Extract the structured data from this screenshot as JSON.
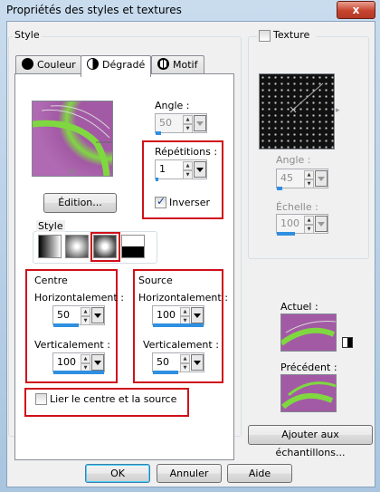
{
  "window": {
    "title": "Propriétés des styles et textures",
    "close_glyph": "x"
  },
  "style_group": {
    "label": "Style",
    "tabs": [
      {
        "label": "Couleur",
        "icon": "color-circle-icon",
        "active": false
      },
      {
        "label": "Dégradé",
        "icon": "gradient-circle-icon",
        "active": true
      },
      {
        "label": "Motif",
        "icon": "pattern-globe-icon",
        "active": false
      }
    ]
  },
  "gradient": {
    "edit_button": "Édition...",
    "angle_label": "Angle :",
    "angle_value": "50",
    "repetitions_label": "Répétitions :",
    "repetitions_value": "1",
    "invert_label": "Inverser",
    "invert_checked": true,
    "style_label": "Style",
    "style_buttons": [
      "linear-style-icon",
      "rectangular-style-icon",
      "sunburst-style-icon",
      "radial-style-icon"
    ],
    "selected_style": "sunburst-style-icon",
    "center": {
      "label": "Centre",
      "h_label": "Horizontalement :",
      "h_value": "50",
      "v_label": "Verticalement :",
      "v_value": "100"
    },
    "source": {
      "label": "Source",
      "h_label": "Horizontalement :",
      "h_value": "100",
      "v_label": "Verticalement :",
      "v_value": "50"
    },
    "link_label": "Lier le centre et la source",
    "link_checked": false
  },
  "texture": {
    "label": "Texture",
    "checked": false,
    "angle_label": "Angle :",
    "angle_value": "45",
    "scale_label": "Échelle :",
    "scale_value": "100"
  },
  "current": {
    "label": "Actuel :"
  },
  "previous": {
    "label": "Précédent :"
  },
  "add_samples_button": "Ajouter aux échantillons...",
  "footer": {
    "ok": "OK",
    "cancel": "Annuler",
    "help": "Aide"
  },
  "colors": {
    "purple": "#a35aa5",
    "green": "#7fd840",
    "highlight": "#d0101a",
    "accent_blue": "#2f8fe0"
  }
}
